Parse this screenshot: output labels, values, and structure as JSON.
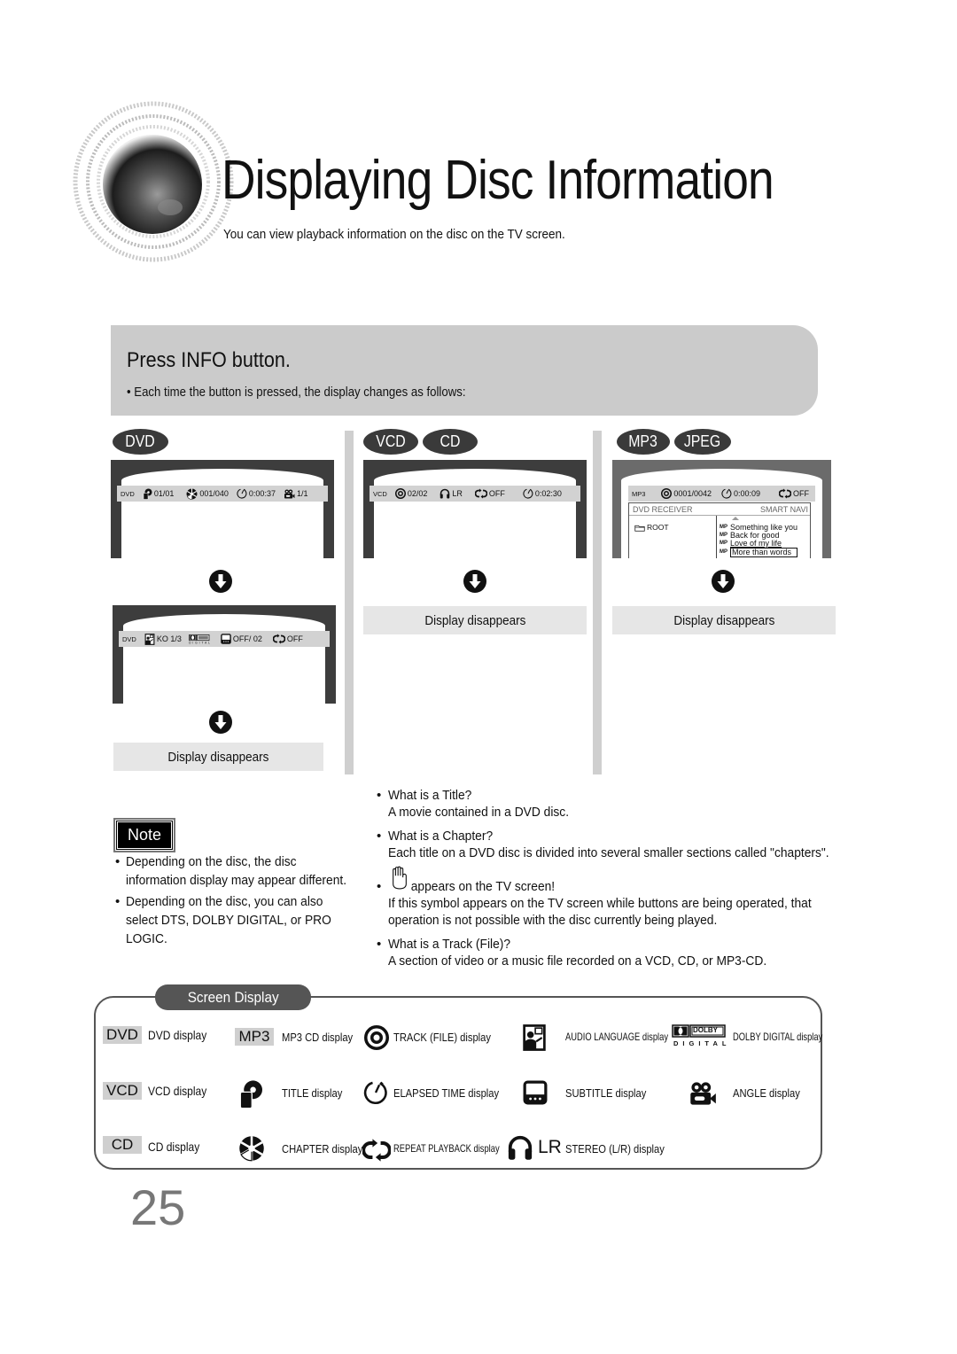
{
  "header": {
    "title": "Displaying Disc Information",
    "subtitle": "You can view playback information on the disc on the TV screen."
  },
  "banner": {
    "title": "Press INFO button.",
    "bullet": "Each time the button is pressed, the display changes as follows:"
  },
  "columns": {
    "dvd": {
      "badges": [
        "DVD"
      ],
      "screen1": {
        "disc_tag": "DVD",
        "title_value": "01/01",
        "chapter_value": "001/040",
        "elapsed_time": "0:00:37",
        "angle_value": "1/1"
      },
      "screen2": {
        "disc_tag": "DVD",
        "audio_language": "KO 1/3",
        "subtitle_value": "OFF/ 02",
        "repeat_value": "OFF"
      },
      "final_label": "Display disappears"
    },
    "vcd_cd": {
      "badges": [
        "VCD",
        "CD"
      ],
      "screen1": {
        "disc_tag": "VCD",
        "track_value": "02/02",
        "stereo_value": "LR",
        "repeat_value": "OFF",
        "elapsed_time": "0:02:30"
      },
      "final_label": "Display disappears"
    },
    "mp3_jpeg": {
      "badges": [
        "MP3",
        "JPEG"
      ],
      "screen1": {
        "disc_tag": "MP3",
        "track_value": "0001/0042",
        "elapsed_time": "0:00:09",
        "repeat_value": "OFF",
        "navi_left_header": "DVD RECEIVER",
        "navi_right_header": "SMART NAVI",
        "folder": "ROOT",
        "file_tag": "MP",
        "files": [
          "Something like you",
          "Back for good",
          "Love of my life",
          "More than words"
        ],
        "selected_file_index": 3
      },
      "final_label": "Display disappears"
    }
  },
  "note": {
    "badge": "Note",
    "items": [
      [
        "Depending on the disc, the disc",
        "information display may appear different."
      ],
      [
        "Depending on the disc, you can also",
        "select DTS, DOLBY DIGITAL, or PRO",
        "LOGIC."
      ]
    ]
  },
  "qa": [
    {
      "q": "What is a Title?",
      "a": [
        "A movie contained in a DVD disc."
      ]
    },
    {
      "q": "What is a Chapter?",
      "a": [
        "Each title on a DVD disc is divided into several smaller sections called \"chapters\"."
      ]
    },
    {
      "q": "appears on the TV screen!",
      "icon": "hand-icon",
      "a": [
        "If this symbol appears on the TV screen while buttons are being operated, that",
        "operation is not possible with the disc currently being played."
      ]
    },
    {
      "q": "What is a Track (File)?",
      "a": [
        "A section of video or a music file recorded on a VCD, CD, or MP3-CD."
      ]
    }
  ],
  "legend": {
    "tab": "Screen Display",
    "items": {
      "dvd": {
        "badge": "DVD",
        "label": "DVD display"
      },
      "vcd": {
        "badge": "VCD",
        "label": "VCD display"
      },
      "cd": {
        "badge": "CD",
        "label": "CD display"
      },
      "mp3": {
        "badge": "MP3",
        "label": "MP3 CD display"
      },
      "title": {
        "icon": "title-icon",
        "label": "TITLE display"
      },
      "chapter": {
        "icon": "chapter-icon",
        "label": "CHAPTER display"
      },
      "track": {
        "icon": "track-icon",
        "label": "TRACK (FILE) display"
      },
      "elapsed": {
        "icon": "elapsed-time-icon",
        "label": "ELAPSED TIME display"
      },
      "repeat": {
        "icon": "repeat-icon",
        "label": "REPEAT PLAYBACK display"
      },
      "audio": {
        "icon": "audio-language-icon",
        "label": "AUDIO LANGUAGE display"
      },
      "subtitle": {
        "icon": "subtitle-icon",
        "label": "SUBTITLE display"
      },
      "stereo": {
        "icon": "headphones-icon",
        "badge": "LR",
        "label": "STEREO (L/R) display"
      },
      "dolby": {
        "icon": "dolby-digital-icon",
        "logo_top": "DOLBY",
        "logo_bottom": "DIGITAL",
        "label": "DOLBY DIGITAL display"
      },
      "angle": {
        "icon": "angle-icon",
        "label": "ANGLE display"
      }
    }
  },
  "page_number": "25"
}
